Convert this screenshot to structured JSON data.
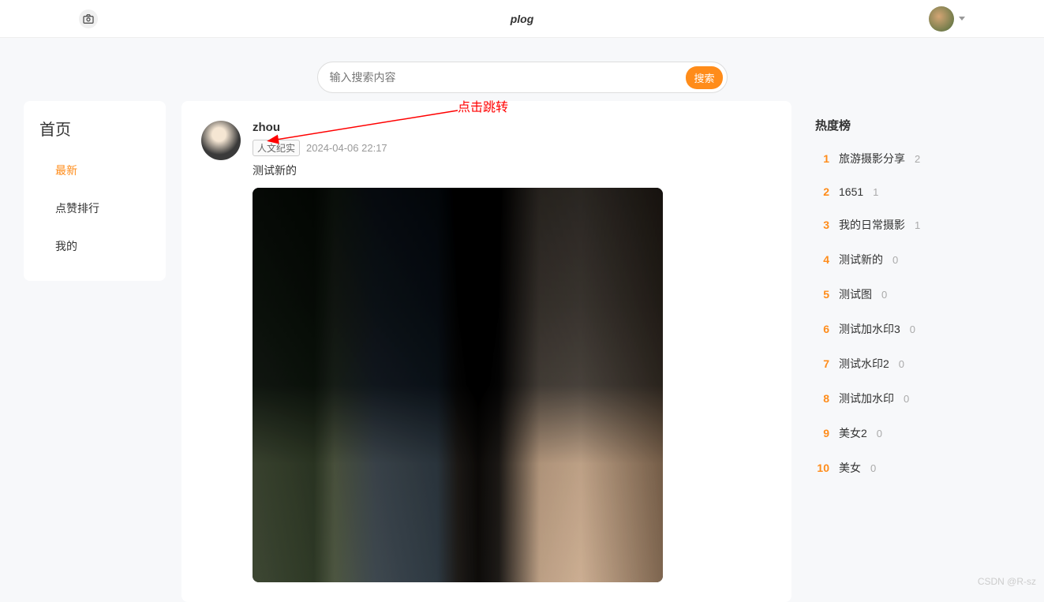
{
  "header": {
    "title": "plog",
    "logo_icon": "camera-icon"
  },
  "search": {
    "placeholder": "输入搜索内容",
    "button_label": "搜索"
  },
  "annotation": {
    "text": "点击跳转"
  },
  "sidebar": {
    "title": "首页",
    "items": [
      {
        "label": "最新",
        "active": true
      },
      {
        "label": "点赞排行",
        "active": false
      },
      {
        "label": "我的",
        "active": false
      }
    ]
  },
  "post": {
    "author": "zhou",
    "tag": "人文纪实",
    "timestamp": "2024-04-06 22:17",
    "text": "测试新的"
  },
  "hotlist": {
    "title": "热度榜",
    "items": [
      {
        "rank": "1",
        "name": "旅游摄影分享",
        "count": "2"
      },
      {
        "rank": "2",
        "name": "1651",
        "count": "1"
      },
      {
        "rank": "3",
        "name": "我的日常摄影",
        "count": "1"
      },
      {
        "rank": "4",
        "name": "测试新的",
        "count": "0"
      },
      {
        "rank": "5",
        "name": "测试图",
        "count": "0"
      },
      {
        "rank": "6",
        "name": "测试加水印3",
        "count": "0"
      },
      {
        "rank": "7",
        "name": "测试水印2",
        "count": "0"
      },
      {
        "rank": "8",
        "name": "测试加水印",
        "count": "0"
      },
      {
        "rank": "9",
        "name": "美女2",
        "count": "0"
      },
      {
        "rank": "10",
        "name": "美女",
        "count": "0"
      }
    ]
  },
  "watermark": "CSDN @R-sz"
}
